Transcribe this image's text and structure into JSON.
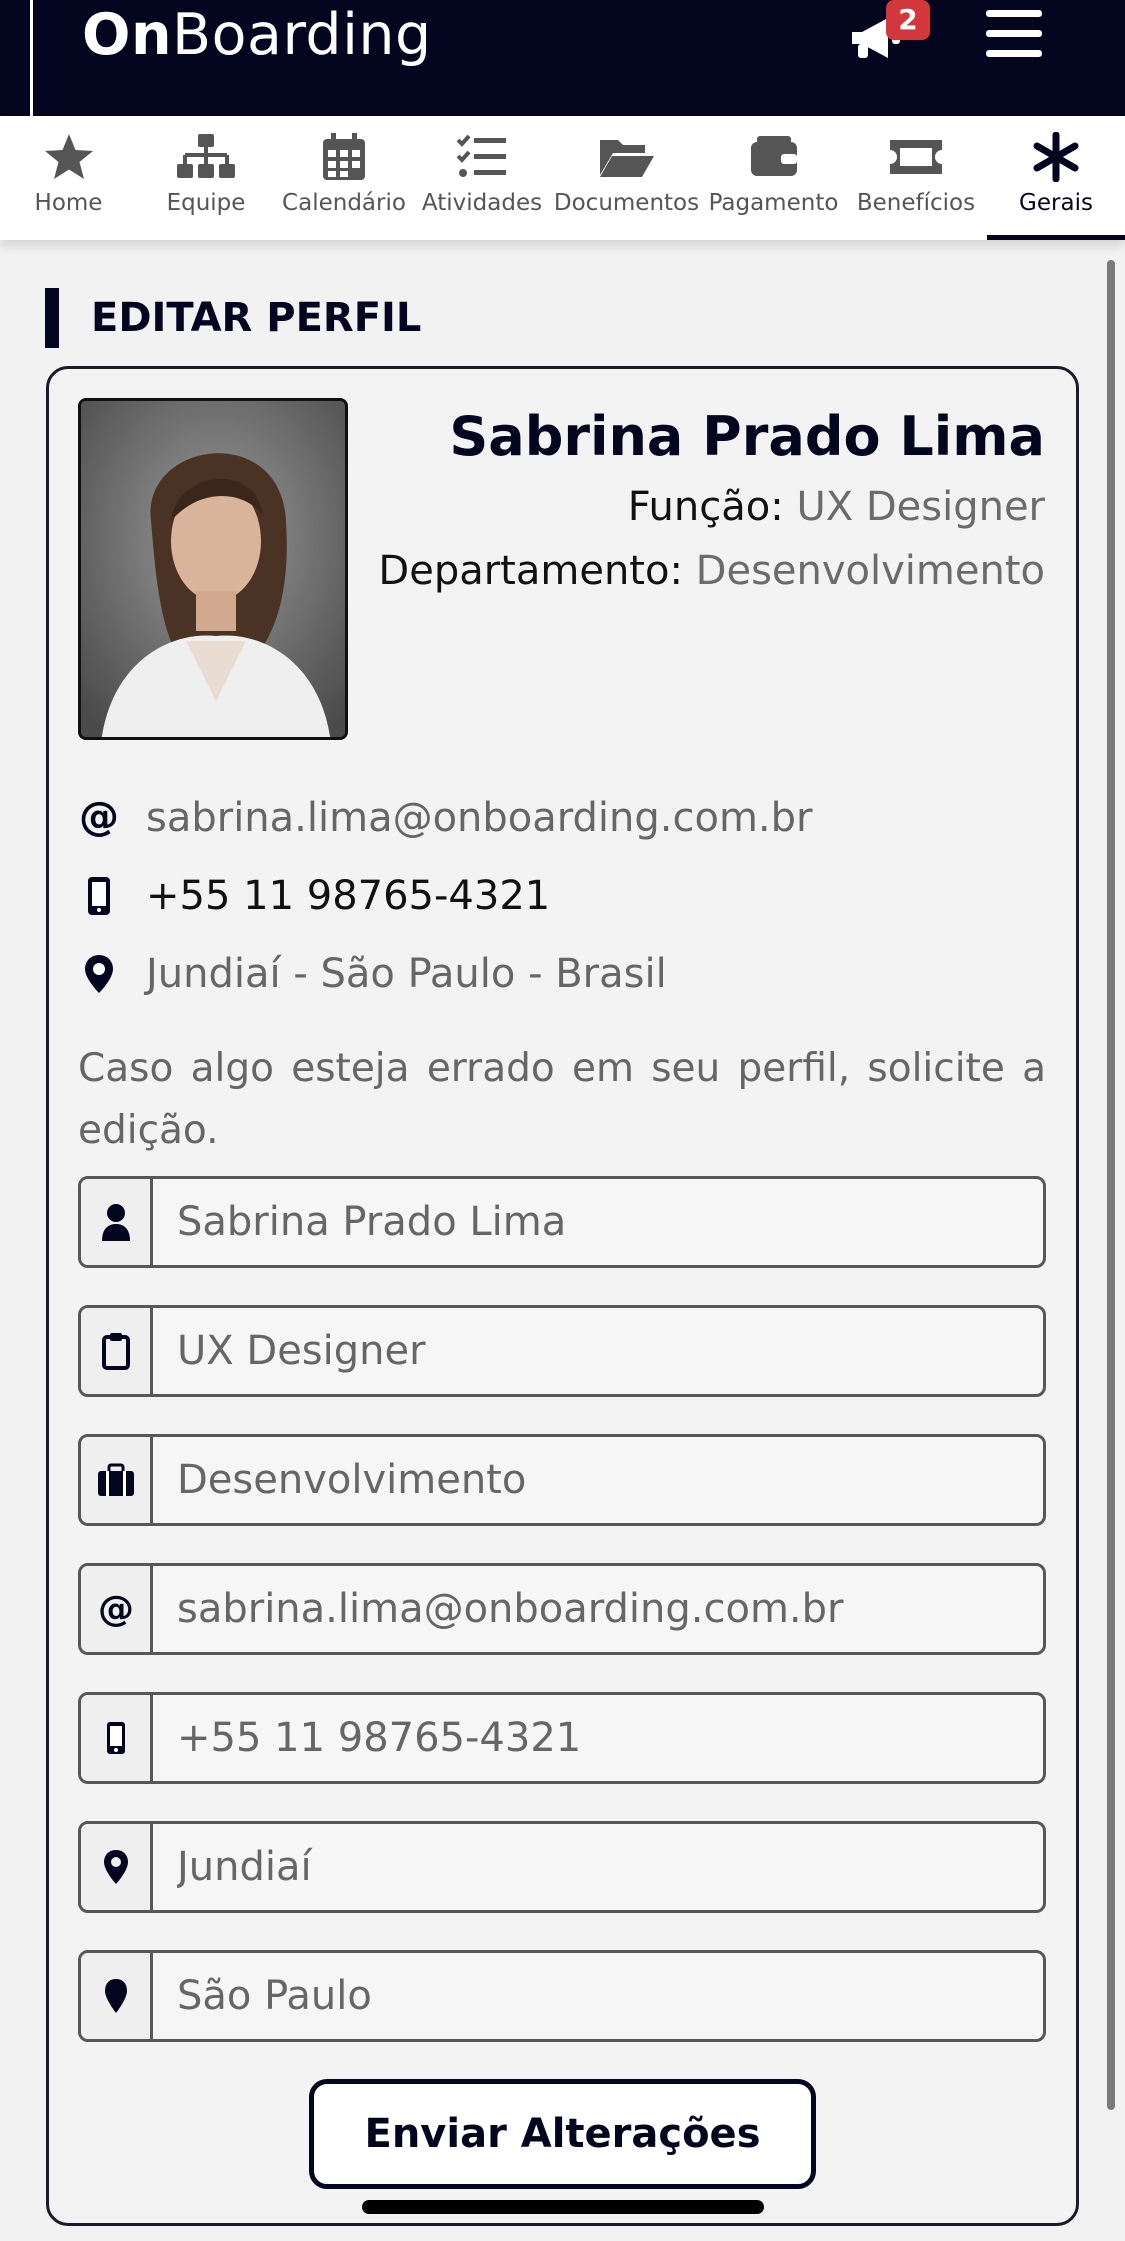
{
  "header": {
    "brand_bold": "On",
    "brand_rest": "Boarding",
    "notification_count": "2",
    "icons": {
      "notifications": "megaphone-icon",
      "menu": "hamburger-menu-icon"
    }
  },
  "tabs": [
    {
      "label": "Home",
      "icon": "star-icon",
      "active": false
    },
    {
      "label": "Equipe",
      "icon": "org-chart-icon",
      "active": false
    },
    {
      "label": "Calendário",
      "icon": "calendar-icon",
      "active": false
    },
    {
      "label": "Atividades",
      "icon": "checklist-icon",
      "active": false
    },
    {
      "label": "Documentos",
      "icon": "folder-open-icon",
      "active": false
    },
    {
      "label": "Pagamento",
      "icon": "wallet-icon",
      "active": false
    },
    {
      "label": "Benefícios",
      "icon": "ticket-icon",
      "active": false
    },
    {
      "label": "Gerais",
      "icon": "asterisk-icon",
      "active": true
    }
  ],
  "section": {
    "title": "EDITAR PERFIL"
  },
  "profile": {
    "name": "Sabrina Prado Lima",
    "role_label": "Função:",
    "role_value": "UX Designer",
    "dept_label": "Departamento:",
    "dept_value": "Desenvolvimento",
    "email": "sabrina.lima@onboarding.com.br",
    "phone": "+55 11 98765-4321",
    "location": "Jundiaí - São Paulo - Brasil"
  },
  "note": "Caso algo esteja errado em seu perfil, solicite a edição.",
  "form": {
    "fields": [
      {
        "icon": "user-icon",
        "value": "Sabrina Prado Lima"
      },
      {
        "icon": "clipboard-icon",
        "value": "UX Designer"
      },
      {
        "icon": "briefcase-icon",
        "value": "Desenvolvimento"
      },
      {
        "icon": "at-icon",
        "value": "sabrina.lima@onboarding.com.br"
      },
      {
        "icon": "mobile-icon",
        "value": "+55 11 98765-4321"
      },
      {
        "icon": "map-marker-icon",
        "value": "Jundiaí"
      },
      {
        "icon": "map-pin-icon",
        "value": "São Paulo"
      }
    ],
    "submit_label": "Enviar Alterações"
  },
  "colors": {
    "navy": "#04051e",
    "badge": "#d2373c",
    "muted": "#6b6b6b"
  }
}
